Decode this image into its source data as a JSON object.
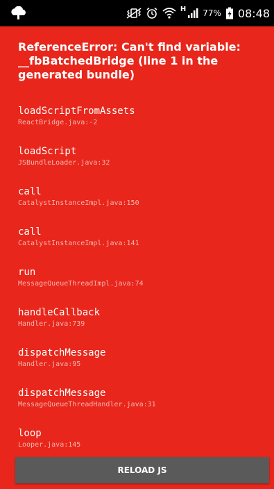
{
  "status_bar": {
    "left_icon": "cloud-icon",
    "icons": [
      "vibrate-icon",
      "alarm-icon",
      "wifi-icon",
      "signal-icon",
      "battery-icon"
    ],
    "network_type": "H",
    "battery_percent": "77%",
    "time": "08:48"
  },
  "error": {
    "title": "ReferenceError: Can't find variable: __fbBatchedBridge (line 1 in the generated bundle)"
  },
  "stack": [
    {
      "method": "loadScriptFromAssets",
      "location": "ReactBridge.java:-2"
    },
    {
      "method": "loadScript",
      "location": "JSBundleLoader.java:32"
    },
    {
      "method": "call",
      "location": "CatalystInstanceImpl.java:150"
    },
    {
      "method": "call",
      "location": "CatalystInstanceImpl.java:141"
    },
    {
      "method": "run",
      "location": "MessageQueueThreadImpl.java:74"
    },
    {
      "method": "handleCallback",
      "location": "Handler.java:739"
    },
    {
      "method": "dispatchMessage",
      "location": "Handler.java:95"
    },
    {
      "method": "dispatchMessage",
      "location": "MessageQueueThreadHandler.java:31"
    },
    {
      "method": "loop",
      "location": "Looper.java:145"
    }
  ],
  "reload_button": {
    "label": "RELOAD JS"
  },
  "colors": {
    "background": "#e8261b",
    "file_text": "#f9b4ad",
    "button": "#5a5a5a"
  }
}
